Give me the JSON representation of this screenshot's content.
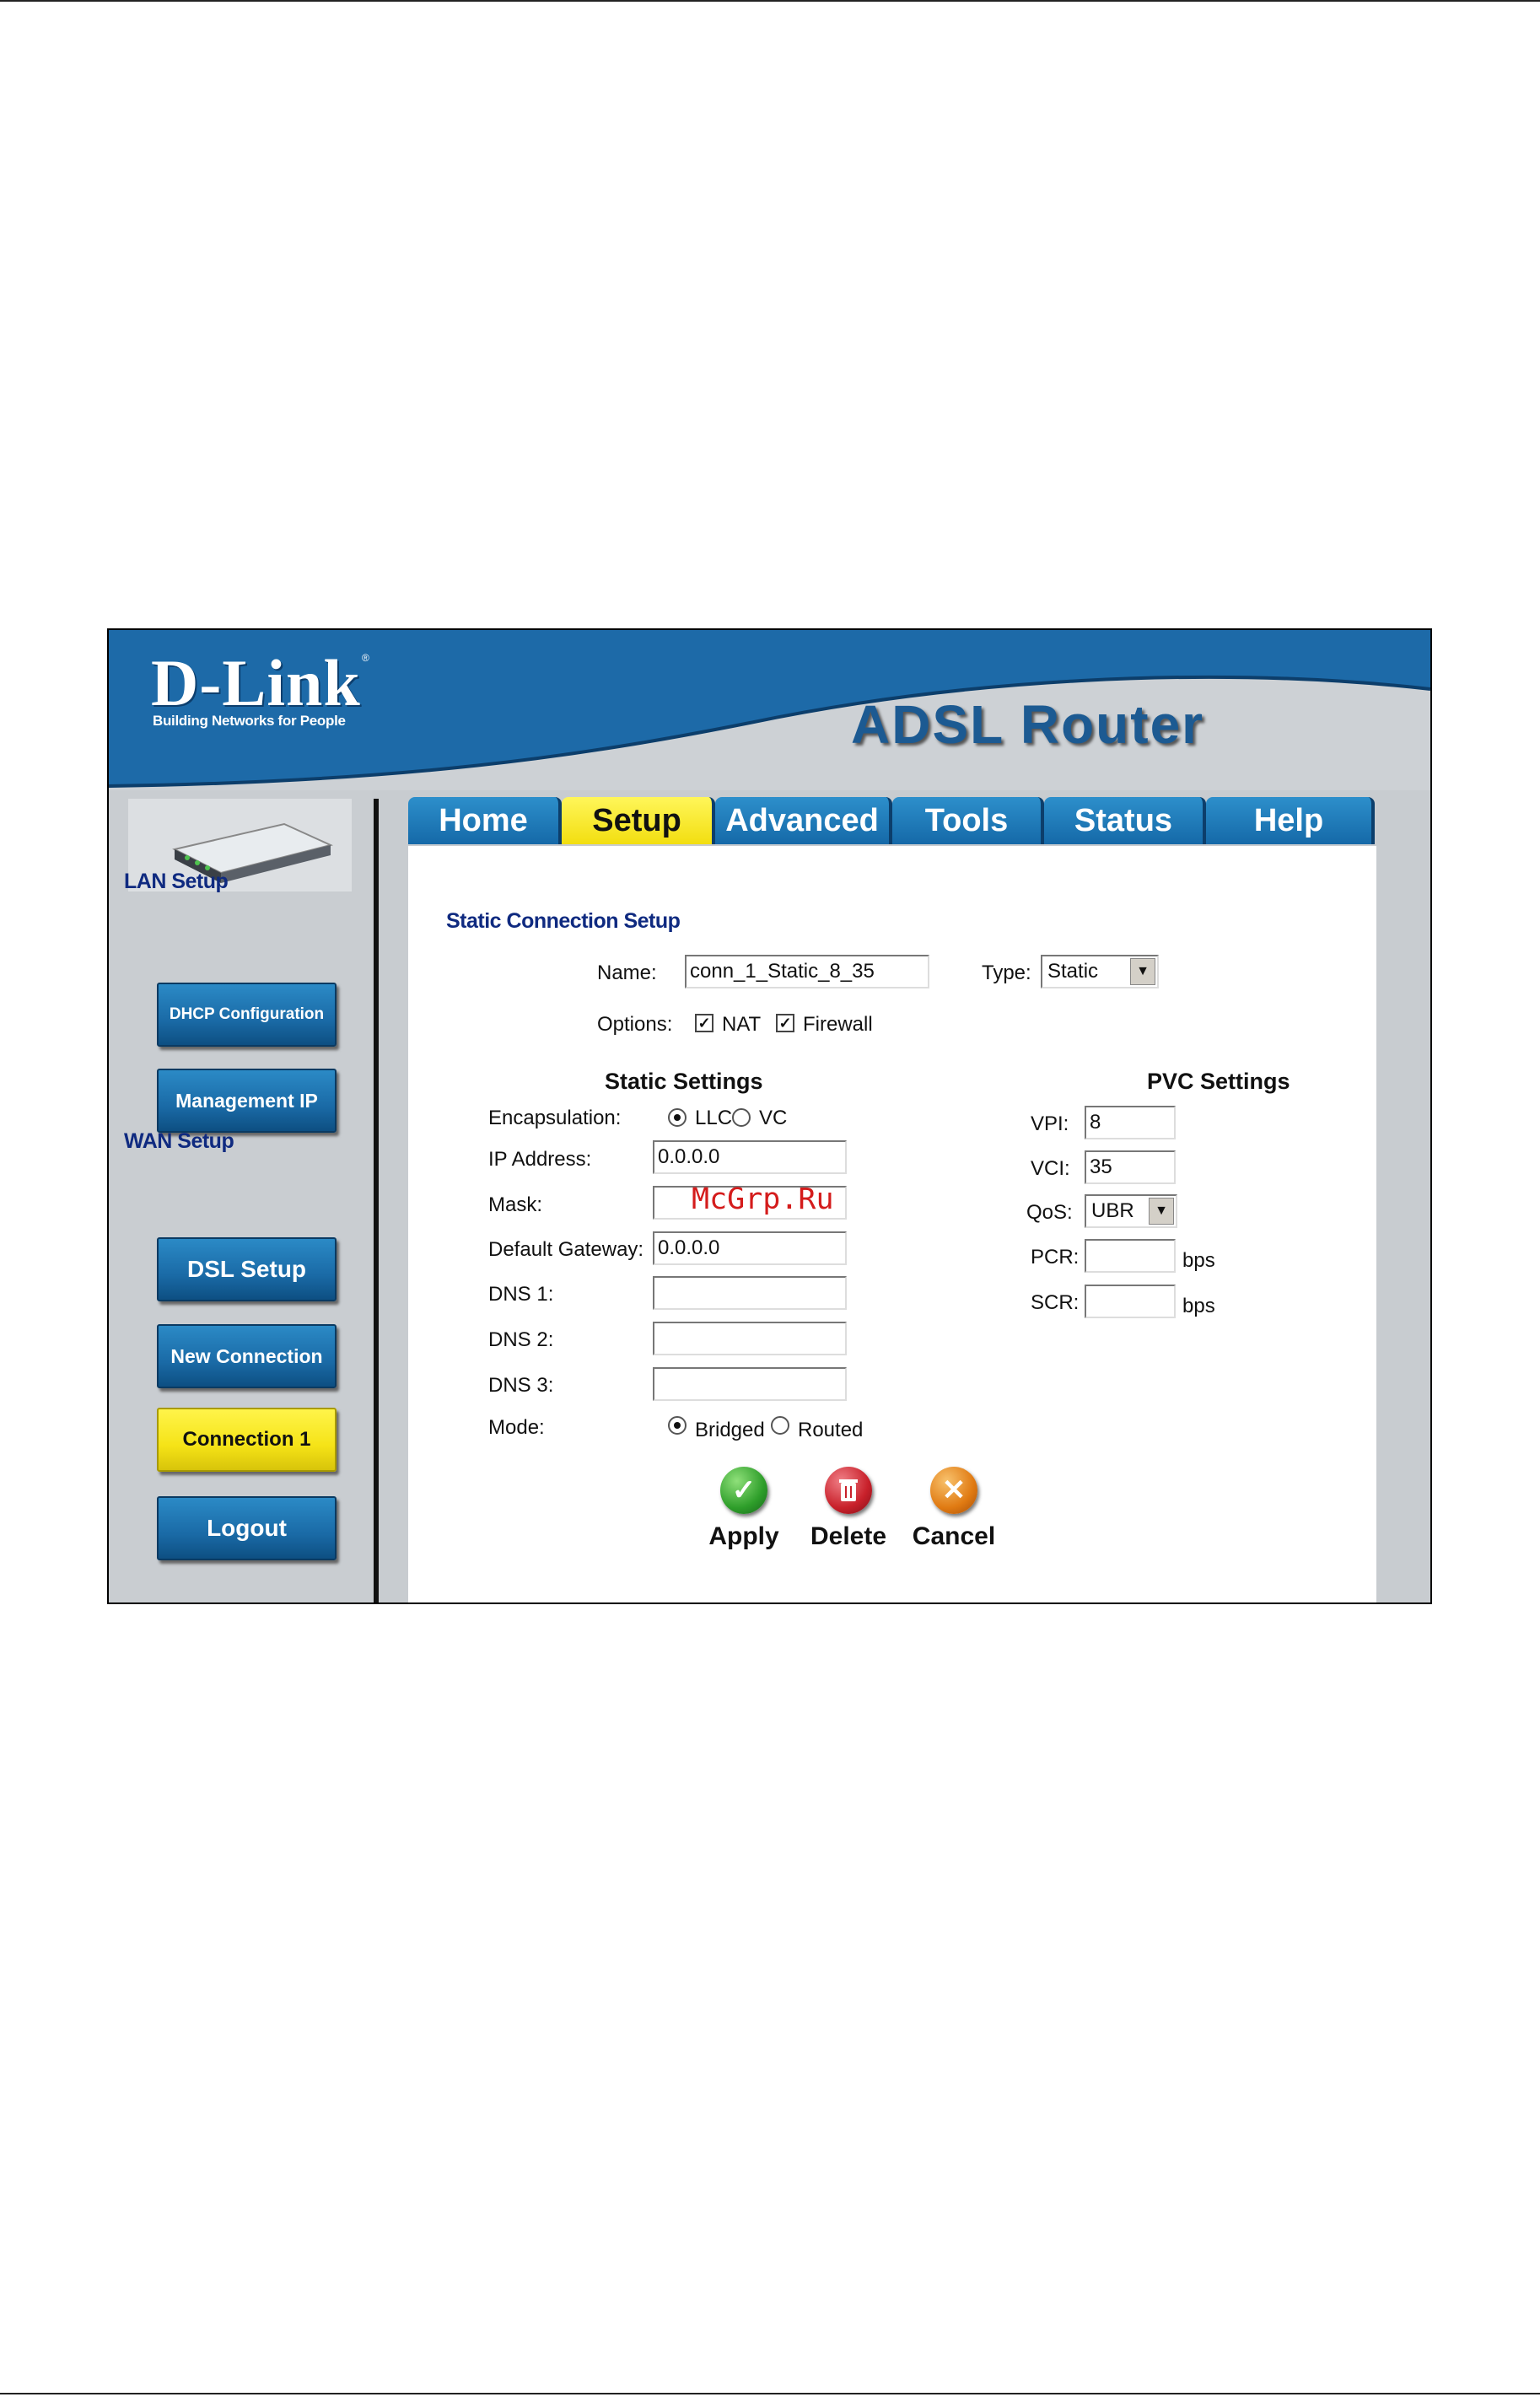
{
  "brand": {
    "logo": "D-Link",
    "tagline": "Building Networks for People",
    "product": "ADSL Router"
  },
  "colors": {
    "header_blue": "#1d6aa8",
    "tab_blue": "#1f79ba",
    "active_yellow": "#f7e71c",
    "sidebar_gray": "#c9cdd1",
    "label_navy": "#0f2a80"
  },
  "tabs": [
    {
      "label": "Home",
      "active": false
    },
    {
      "label": "Setup",
      "active": true
    },
    {
      "label": "Advanced",
      "active": false
    },
    {
      "label": "Tools",
      "active": false
    },
    {
      "label": "Status",
      "active": false
    },
    {
      "label": "Help",
      "active": false
    }
  ],
  "sidebar": {
    "device_icon": "router-device-icon",
    "lan_label": "LAN Setup",
    "wan_label": "WAN Setup",
    "lan_buttons": [
      {
        "label": "DHCP Configuration"
      },
      {
        "label": "Management IP"
      }
    ],
    "wan_buttons": [
      {
        "label": "DSL Setup"
      },
      {
        "label": "New Connection"
      },
      {
        "label": "Connection 1",
        "active": true
      },
      {
        "label": "Logout"
      }
    ]
  },
  "form": {
    "title": "Static Connection Setup",
    "name_label": "Name:",
    "name_value": "conn_1_Static_8_35",
    "type_label": "Type:",
    "type_value": "Static",
    "options_label": "Options:",
    "nat_label": "NAT",
    "nat_checked": true,
    "firewall_label": "Firewall",
    "firewall_checked": true,
    "static_header": "Static Settings",
    "encapsulation_label": "Encapsulation:",
    "llc_label": "LLC",
    "vc_label": "VC",
    "encapsulation_value": "LLC",
    "ip_label": "IP Address:",
    "ip_value": "0.0.0.0",
    "mask_label": "Mask:",
    "mask_value": "",
    "gateway_label": "Default Gateway:",
    "gateway_value": "0.0.0.0",
    "dns1_label": "DNS 1:",
    "dns1_value": "",
    "dns2_label": "DNS 2:",
    "dns2_value": "",
    "dns3_label": "DNS 3:",
    "dns3_value": "",
    "mode_label": "Mode:",
    "bridged_label": "Bridged",
    "routed_label": "Routed",
    "mode_value": "Bridged",
    "pvc_header": "PVC Settings",
    "vpi_label": "VPI:",
    "vpi_value": "8",
    "vci_label": "VCI:",
    "vci_value": "35",
    "qos_label": "QoS:",
    "qos_value": "UBR",
    "pcr_label": "PCR:",
    "pcr_value": "",
    "pcr_unit": "bps",
    "scr_label": "SCR:",
    "scr_value": "",
    "scr_unit": "bps"
  },
  "actions": [
    {
      "label": "Apply",
      "icon": "check-icon",
      "color": "#2e9e2a"
    },
    {
      "label": "Delete",
      "icon": "trash-icon",
      "color": "#c8202a"
    },
    {
      "label": "Cancel",
      "icon": "close-icon",
      "color": "#e07a12"
    }
  ],
  "watermark": "McGrp.Ru"
}
